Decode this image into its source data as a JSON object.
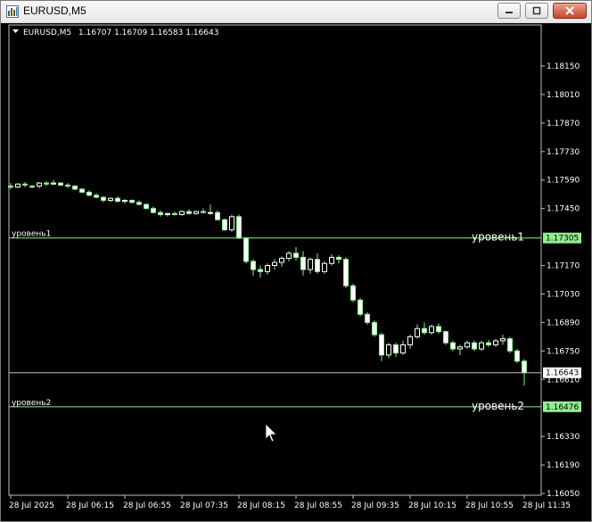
{
  "window": {
    "title": "EURUSD,M5"
  },
  "chart_header": {
    "symbol": "EURUSD,M5",
    "ohlc": "1.16707 1.16709 1.16583 1.16643"
  },
  "colors": {
    "background": "#000000",
    "candle_up": "#ffffff",
    "candle_down": "#ffffff",
    "wick": "#90ee90",
    "level_line": "#90ee90",
    "price_line": "#c0c0c0",
    "badge": "#90ee90"
  },
  "levels": [
    {
      "name": "уровень1",
      "price": 1.17305,
      "price_label": "1.17305"
    },
    {
      "name": "уровень2",
      "price": 1.16476,
      "price_label": "1.16476"
    }
  ],
  "current_price": {
    "price": 1.16643,
    "label": "1.16643"
  },
  "chart_data": {
    "type": "candlestick",
    "title": "EURUSD,M5",
    "ylim": [
      1.1605,
      1.1822
    ],
    "y_ticks": [
      "1.18150",
      "1.18010",
      "1.17870",
      "1.17730",
      "1.17590",
      "1.17450",
      "1.17170",
      "1.17030",
      "1.16890",
      "1.16750",
      "1.16610",
      "1.16330",
      "1.16190",
      "1.16050"
    ],
    "y_tick_values": [
      1.1815,
      1.1801,
      1.1787,
      1.1773,
      1.1759,
      1.1745,
      1.1717,
      1.1703,
      1.1689,
      1.1675,
      1.1661,
      1.1633,
      1.1619,
      1.1605
    ],
    "x_ticks": [
      "28 Jul 2025",
      "28 Jul 06:15",
      "28 Jul 06:55",
      "28 Jul 07:35",
      "28 Jul 08:15",
      "28 Jul 08:55",
      "28 Jul 09:35",
      "28 Jul 10:15",
      "28 Jul 10:55",
      "28 Jul 11:35"
    ],
    "x_tick_index": [
      0,
      8,
      16,
      24,
      32,
      40,
      48,
      56,
      64,
      72
    ],
    "candles": [
      [
        1.1756,
        1.17575,
        1.17545,
        1.17555
      ],
      [
        1.17555,
        1.17575,
        1.1755,
        1.1757
      ],
      [
        1.1757,
        1.1758,
        1.17555,
        1.17565
      ],
      [
        1.1756,
        1.17565,
        1.1755,
        1.17555
      ],
      [
        1.1756,
        1.1758,
        1.1755,
        1.17575
      ],
      [
        1.17575,
        1.17585,
        1.1756,
        1.1757
      ],
      [
        1.1757,
        1.1759,
        1.17565,
        1.17575
      ],
      [
        1.17575,
        1.1758,
        1.1756,
        1.17565
      ],
      [
        1.17565,
        1.17575,
        1.1755,
        1.1756
      ],
      [
        1.1756,
        1.17565,
        1.1754,
        1.17545
      ],
      [
        1.17545,
        1.1755,
        1.17525,
        1.1753
      ],
      [
        1.1753,
        1.1754,
        1.1751,
        1.17515
      ],
      [
        1.17515,
        1.17525,
        1.175,
        1.17505
      ],
      [
        1.17505,
        1.1751,
        1.1748,
        1.1749
      ],
      [
        1.1749,
        1.17505,
        1.1748,
        1.175
      ],
      [
        1.175,
        1.1751,
        1.1748,
        1.17485
      ],
      [
        1.17485,
        1.17495,
        1.17475,
        1.1749
      ],
      [
        1.1749,
        1.17495,
        1.17475,
        1.1748
      ],
      [
        1.1748,
        1.1749,
        1.17465,
        1.1747
      ],
      [
        1.1747,
        1.17475,
        1.17445,
        1.1745
      ],
      [
        1.1745,
        1.1746,
        1.17425,
        1.1743
      ],
      [
        1.1743,
        1.1744,
        1.1741,
        1.1742
      ],
      [
        1.1742,
        1.1743,
        1.1741,
        1.17425
      ],
      [
        1.17425,
        1.17435,
        1.17415,
        1.1742
      ],
      [
        1.1742,
        1.1744,
        1.17415,
        1.17435
      ],
      [
        1.17435,
        1.17445,
        1.1742,
        1.17425
      ],
      [
        1.17425,
        1.1744,
        1.1742,
        1.17435
      ],
      [
        1.17435,
        1.1745,
        1.17425,
        1.1743
      ],
      [
        1.1743,
        1.1747,
        1.1742,
        1.1743
      ],
      [
        1.1743,
        1.1744,
        1.1739,
        1.17395
      ],
      [
        1.17395,
        1.174,
        1.1734,
        1.17345
      ],
      [
        1.17345,
        1.1742,
        1.17335,
        1.1741
      ],
      [
        1.1741,
        1.1742,
        1.173,
        1.17305
      ],
      [
        1.17305,
        1.1731,
        1.1718,
        1.1719
      ],
      [
        1.1719,
        1.172,
        1.1712,
        1.1715
      ],
      [
        1.1715,
        1.1717,
        1.1711,
        1.1714
      ],
      [
        1.1714,
        1.1718,
        1.17125,
        1.1717
      ],
      [
        1.1717,
        1.172,
        1.1715,
        1.17185
      ],
      [
        1.17185,
        1.17215,
        1.17165,
        1.17205
      ],
      [
        1.17205,
        1.1724,
        1.1719,
        1.1723
      ],
      [
        1.1723,
        1.1726,
        1.17195,
        1.1721
      ],
      [
        1.1721,
        1.1724,
        1.1712,
        1.1715
      ],
      [
        1.1715,
        1.1721,
        1.1713,
        1.172
      ],
      [
        1.172,
        1.1723,
        1.1713,
        1.1714
      ],
      [
        1.1714,
        1.1719,
        1.1713,
        1.1718
      ],
      [
        1.1718,
        1.17225,
        1.1717,
        1.1721
      ],
      [
        1.1721,
        1.1722,
        1.1718,
        1.172
      ],
      [
        1.172,
        1.1721,
        1.1706,
        1.1707
      ],
      [
        1.1707,
        1.1708,
        1.1699,
        1.17
      ],
      [
        1.17,
        1.1701,
        1.1692,
        1.1693
      ],
      [
        1.1693,
        1.1694,
        1.1688,
        1.1689
      ],
      [
        1.1689,
        1.169,
        1.1682,
        1.1683
      ],
      [
        1.1683,
        1.1684,
        1.167,
        1.1673
      ],
      [
        1.1673,
        1.1679,
        1.16715,
        1.1678
      ],
      [
        1.1678,
        1.1679,
        1.1672,
        1.1674
      ],
      [
        1.1674,
        1.168,
        1.1673,
        1.1678
      ],
      [
        1.1678,
        1.1683,
        1.1676,
        1.1682
      ],
      [
        1.1682,
        1.1688,
        1.1681,
        1.1686
      ],
      [
        1.1686,
        1.1689,
        1.1683,
        1.1684
      ],
      [
        1.1684,
        1.1688,
        1.1683,
        1.1687
      ],
      [
        1.1687,
        1.16885,
        1.16835,
        1.16845
      ],
      [
        1.16845,
        1.1685,
        1.1678,
        1.1679
      ],
      [
        1.1679,
        1.168,
        1.1675,
        1.1676
      ],
      [
        1.1676,
        1.1678,
        1.1673,
        1.1677
      ],
      [
        1.1677,
        1.168,
        1.1676,
        1.1679
      ],
      [
        1.1679,
        1.168,
        1.1675,
        1.1676
      ],
      [
        1.1676,
        1.168,
        1.1675,
        1.1679
      ],
      [
        1.1679,
        1.16805,
        1.1677,
        1.1678
      ],
      [
        1.1678,
        1.1681,
        1.1677,
        1.168
      ],
      [
        1.168,
        1.1683,
        1.1678,
        1.1681
      ],
      [
        1.1681,
        1.1682,
        1.1674,
        1.1675
      ],
      [
        1.1675,
        1.1676,
        1.1669,
        1.167
      ],
      [
        1.167,
        1.1671,
        1.1658,
        1.16643
      ]
    ]
  }
}
